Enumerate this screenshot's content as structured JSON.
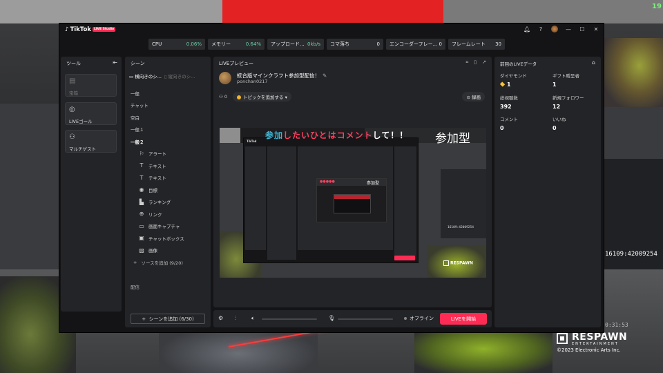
{
  "background": {
    "stream_id": "16109:42009254",
    "timer": "0:31:53",
    "counter": "19",
    "respawn": {
      "name": "RESPAWN",
      "entertainment": "ENTERTAINMENT",
      "copyright": "©2023 Electronic Arts Inc."
    }
  },
  "app": {
    "logo": "TikTok",
    "badge": "LIVE Studio",
    "titlebar_icons": [
      "bell-icon",
      "help-icon",
      "avatar",
      "minimize-icon",
      "maximize-icon",
      "close-icon"
    ]
  },
  "stats": [
    {
      "label": "CPU",
      "value": "0.06%"
    },
    {
      "label": "メモリー",
      "value": "0.64%"
    },
    {
      "label": "アップロード...",
      "value": "0kb/s"
    },
    {
      "label": "コマ落ち",
      "value": "0"
    },
    {
      "label": "エンコーダーフレー...",
      "value": "0"
    },
    {
      "label": "フレームレート",
      "value": "30"
    }
  ],
  "tools": {
    "title": "ツール",
    "items": [
      {
        "label": "宝箱",
        "icon": "treasure-icon"
      },
      {
        "label": "LIVEゴール",
        "icon": "target-icon"
      },
      {
        "label": "マルチゲスト",
        "icon": "guests-icon"
      }
    ]
  },
  "scenes": {
    "title": "シーン",
    "tab_active": "横向きのシ...",
    "tab_inactive": "縦向きのシ...",
    "items": [
      {
        "label": "一般"
      },
      {
        "label": "チャット"
      },
      {
        "label": "空白"
      },
      {
        "label": "一般１"
      },
      {
        "label": "一般２"
      }
    ],
    "sources": [
      {
        "label": "アラート",
        "icon": "alert-icon"
      },
      {
        "label": "テキスト",
        "icon": "text-icon"
      },
      {
        "label": "テキスト",
        "icon": "text-icon"
      },
      {
        "label": "目標",
        "icon": "goal-icon"
      },
      {
        "label": "ランキング",
        "icon": "ranking-icon"
      },
      {
        "label": "リンク",
        "icon": "link-icon"
      },
      {
        "label": "画面キャプチャ",
        "icon": "screen-capture-icon"
      },
      {
        "label": "チャットボックス",
        "icon": "chatbox-icon"
      },
      {
        "label": "画像",
        "icon": "image-icon"
      }
    ],
    "add_source": "ソースを追加 (9/20)",
    "footer": "配信",
    "add_scene": "シーンを追加 (6/30)"
  },
  "preview": {
    "title": "LIVEプレビュー",
    "stream_title": "統合版マインクラフト参加型配信！",
    "username": "ponchan0217",
    "viewers": "0",
    "topic_button": "トピックを追加する",
    "record_button": "録画",
    "overlay_text_a": "参加",
    "overlay_text_b": "したいひとはコメント",
    "overlay_text_c": "して！！",
    "overlay_tag": "参加型",
    "inner_tag": "参加型",
    "inner_logo": "TikTok",
    "inner_stream_id": "16109:42009254",
    "inner_respawn": "RESPAWN"
  },
  "controls": {
    "status": "オフライン",
    "go_live": "LIVEを開始"
  },
  "live_data": {
    "title": "前回のLIVEデータ",
    "metrics": [
      {
        "label": "ダイヤモンド",
        "value": "1"
      },
      {
        "label": "ギフト贈呈者",
        "value": "1"
      },
      {
        "label": "総視聴数",
        "value": "392"
      },
      {
        "label": "新規フォロワー",
        "value": "12"
      },
      {
        "label": "コメント",
        "value": "0"
      },
      {
        "label": "いいね",
        "value": "0"
      }
    ]
  },
  "colors": {
    "accent": "#fe2c55",
    "stat_value": "#6ed3a8",
    "panel": "#232427",
    "window": "#141416"
  }
}
